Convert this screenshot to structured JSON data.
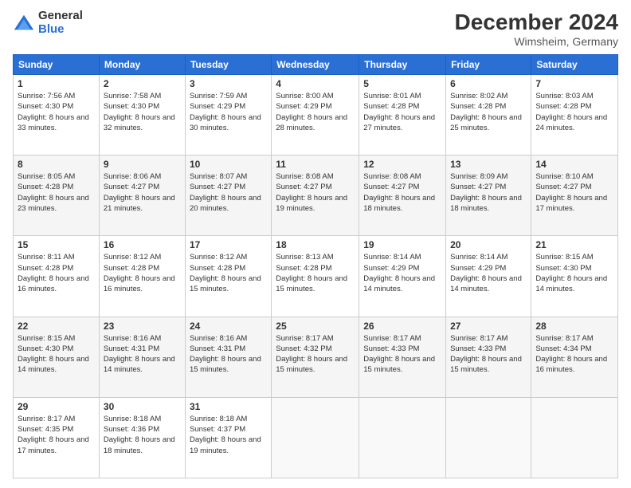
{
  "logo": {
    "general": "General",
    "blue": "Blue"
  },
  "header": {
    "title": "December 2024",
    "subtitle": "Wimsheim, Germany"
  },
  "days": [
    "Sunday",
    "Monday",
    "Tuesday",
    "Wednesday",
    "Thursday",
    "Friday",
    "Saturday"
  ],
  "weeks": [
    [
      {
        "num": "1",
        "rise": "Sunrise: 7:56 AM",
        "set": "Sunset: 4:30 PM",
        "daylight": "Daylight: 8 hours and 33 minutes."
      },
      {
        "num": "2",
        "rise": "Sunrise: 7:58 AM",
        "set": "Sunset: 4:30 PM",
        "daylight": "Daylight: 8 hours and 32 minutes."
      },
      {
        "num": "3",
        "rise": "Sunrise: 7:59 AM",
        "set": "Sunset: 4:29 PM",
        "daylight": "Daylight: 8 hours and 30 minutes."
      },
      {
        "num": "4",
        "rise": "Sunrise: 8:00 AM",
        "set": "Sunset: 4:29 PM",
        "daylight": "Daylight: 8 hours and 28 minutes."
      },
      {
        "num": "5",
        "rise": "Sunrise: 8:01 AM",
        "set": "Sunset: 4:28 PM",
        "daylight": "Daylight: 8 hours and 27 minutes."
      },
      {
        "num": "6",
        "rise": "Sunrise: 8:02 AM",
        "set": "Sunset: 4:28 PM",
        "daylight": "Daylight: 8 hours and 25 minutes."
      },
      {
        "num": "7",
        "rise": "Sunrise: 8:03 AM",
        "set": "Sunset: 4:28 PM",
        "daylight": "Daylight: 8 hours and 24 minutes."
      }
    ],
    [
      {
        "num": "8",
        "rise": "Sunrise: 8:05 AM",
        "set": "Sunset: 4:28 PM",
        "daylight": "Daylight: 8 hours and 23 minutes."
      },
      {
        "num": "9",
        "rise": "Sunrise: 8:06 AM",
        "set": "Sunset: 4:27 PM",
        "daylight": "Daylight: 8 hours and 21 minutes."
      },
      {
        "num": "10",
        "rise": "Sunrise: 8:07 AM",
        "set": "Sunset: 4:27 PM",
        "daylight": "Daylight: 8 hours and 20 minutes."
      },
      {
        "num": "11",
        "rise": "Sunrise: 8:08 AM",
        "set": "Sunset: 4:27 PM",
        "daylight": "Daylight: 8 hours and 19 minutes."
      },
      {
        "num": "12",
        "rise": "Sunrise: 8:08 AM",
        "set": "Sunset: 4:27 PM",
        "daylight": "Daylight: 8 hours and 18 minutes."
      },
      {
        "num": "13",
        "rise": "Sunrise: 8:09 AM",
        "set": "Sunset: 4:27 PM",
        "daylight": "Daylight: 8 hours and 18 minutes."
      },
      {
        "num": "14",
        "rise": "Sunrise: 8:10 AM",
        "set": "Sunset: 4:27 PM",
        "daylight": "Daylight: 8 hours and 17 minutes."
      }
    ],
    [
      {
        "num": "15",
        "rise": "Sunrise: 8:11 AM",
        "set": "Sunset: 4:28 PM",
        "daylight": "Daylight: 8 hours and 16 minutes."
      },
      {
        "num": "16",
        "rise": "Sunrise: 8:12 AM",
        "set": "Sunset: 4:28 PM",
        "daylight": "Daylight: 8 hours and 16 minutes."
      },
      {
        "num": "17",
        "rise": "Sunrise: 8:12 AM",
        "set": "Sunset: 4:28 PM",
        "daylight": "Daylight: 8 hours and 15 minutes."
      },
      {
        "num": "18",
        "rise": "Sunrise: 8:13 AM",
        "set": "Sunset: 4:28 PM",
        "daylight": "Daylight: 8 hours and 15 minutes."
      },
      {
        "num": "19",
        "rise": "Sunrise: 8:14 AM",
        "set": "Sunset: 4:29 PM",
        "daylight": "Daylight: 8 hours and 14 minutes."
      },
      {
        "num": "20",
        "rise": "Sunrise: 8:14 AM",
        "set": "Sunset: 4:29 PM",
        "daylight": "Daylight: 8 hours and 14 minutes."
      },
      {
        "num": "21",
        "rise": "Sunrise: 8:15 AM",
        "set": "Sunset: 4:30 PM",
        "daylight": "Daylight: 8 hours and 14 minutes."
      }
    ],
    [
      {
        "num": "22",
        "rise": "Sunrise: 8:15 AM",
        "set": "Sunset: 4:30 PM",
        "daylight": "Daylight: 8 hours and 14 minutes."
      },
      {
        "num": "23",
        "rise": "Sunrise: 8:16 AM",
        "set": "Sunset: 4:31 PM",
        "daylight": "Daylight: 8 hours and 14 minutes."
      },
      {
        "num": "24",
        "rise": "Sunrise: 8:16 AM",
        "set": "Sunset: 4:31 PM",
        "daylight": "Daylight: 8 hours and 15 minutes."
      },
      {
        "num": "25",
        "rise": "Sunrise: 8:17 AM",
        "set": "Sunset: 4:32 PM",
        "daylight": "Daylight: 8 hours and 15 minutes."
      },
      {
        "num": "26",
        "rise": "Sunrise: 8:17 AM",
        "set": "Sunset: 4:33 PM",
        "daylight": "Daylight: 8 hours and 15 minutes."
      },
      {
        "num": "27",
        "rise": "Sunrise: 8:17 AM",
        "set": "Sunset: 4:33 PM",
        "daylight": "Daylight: 8 hours and 15 minutes."
      },
      {
        "num": "28",
        "rise": "Sunrise: 8:17 AM",
        "set": "Sunset: 4:34 PM",
        "daylight": "Daylight: 8 hours and 16 minutes."
      }
    ],
    [
      {
        "num": "29",
        "rise": "Sunrise: 8:17 AM",
        "set": "Sunset: 4:35 PM",
        "daylight": "Daylight: 8 hours and 17 minutes."
      },
      {
        "num": "30",
        "rise": "Sunrise: 8:18 AM",
        "set": "Sunset: 4:36 PM",
        "daylight": "Daylight: 8 hours and 18 minutes."
      },
      {
        "num": "31",
        "rise": "Sunrise: 8:18 AM",
        "set": "Sunset: 4:37 PM",
        "daylight": "Daylight: 8 hours and 19 minutes."
      },
      null,
      null,
      null,
      null
    ]
  ]
}
